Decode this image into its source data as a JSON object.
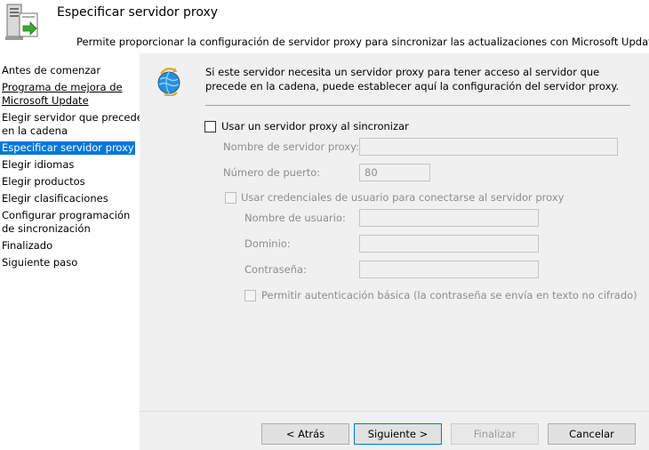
{
  "header": {
    "title": "Especificar servidor proxy",
    "description": "Permite proporcionar la configuración de servidor proxy para sincronizar las actualizaciones con Microsoft Update",
    "icon": "server-sync-icon"
  },
  "nav": {
    "items": [
      {
        "label": "Antes de comenzar"
      },
      {
        "label_line1": "Programa de mejora de",
        "label_line2": "Microsoft Update"
      },
      {
        "label_line1": "Elegir servidor que precede",
        "label_line2": "en la cadena"
      },
      {
        "label": "Especificar servidor proxy"
      },
      {
        "label": "Elegir idiomas"
      },
      {
        "label": "Elegir productos"
      },
      {
        "label": "Elegir clasificaciones"
      },
      {
        "label_line1": "Configurar programación",
        "label_line2": "de sincronización"
      },
      {
        "label": "Finalizado"
      },
      {
        "label": "Siguiente paso"
      }
    ]
  },
  "info": {
    "text": "Si este servidor necesita un servidor proxy para tener acceso al servidor que precede en la cadena, puede establecer aquí la configuración del servidor proxy.",
    "icon": "globe-sync-icon"
  },
  "form": {
    "use_proxy_label": "Usar un servidor proxy al sincronizar",
    "use_proxy_checked": false,
    "server_name_label": "Nombre de servidor proxy:",
    "server_name_value": "",
    "port_label": "Número de puerto:",
    "port_value": "80",
    "use_credentials_label": "Usar credenciales de usuario para conectarse al servidor proxy",
    "username_label": "Nombre de usuario:",
    "username_value": "",
    "domain_label": "Dominio:",
    "domain_value": "",
    "password_label": "Contraseña:",
    "password_value": "",
    "basic_auth_label": "Permitir autenticación básica (la contraseña se envía en texto no cifrado)"
  },
  "buttons": {
    "back": "< Atrás",
    "next": "Siguiente >",
    "finish": "Finalizar",
    "cancel": "Cancelar"
  },
  "colors": {
    "selection": "#0078d7",
    "panel": "#f0f0f0",
    "disabled_text": "#8d8d8d"
  }
}
